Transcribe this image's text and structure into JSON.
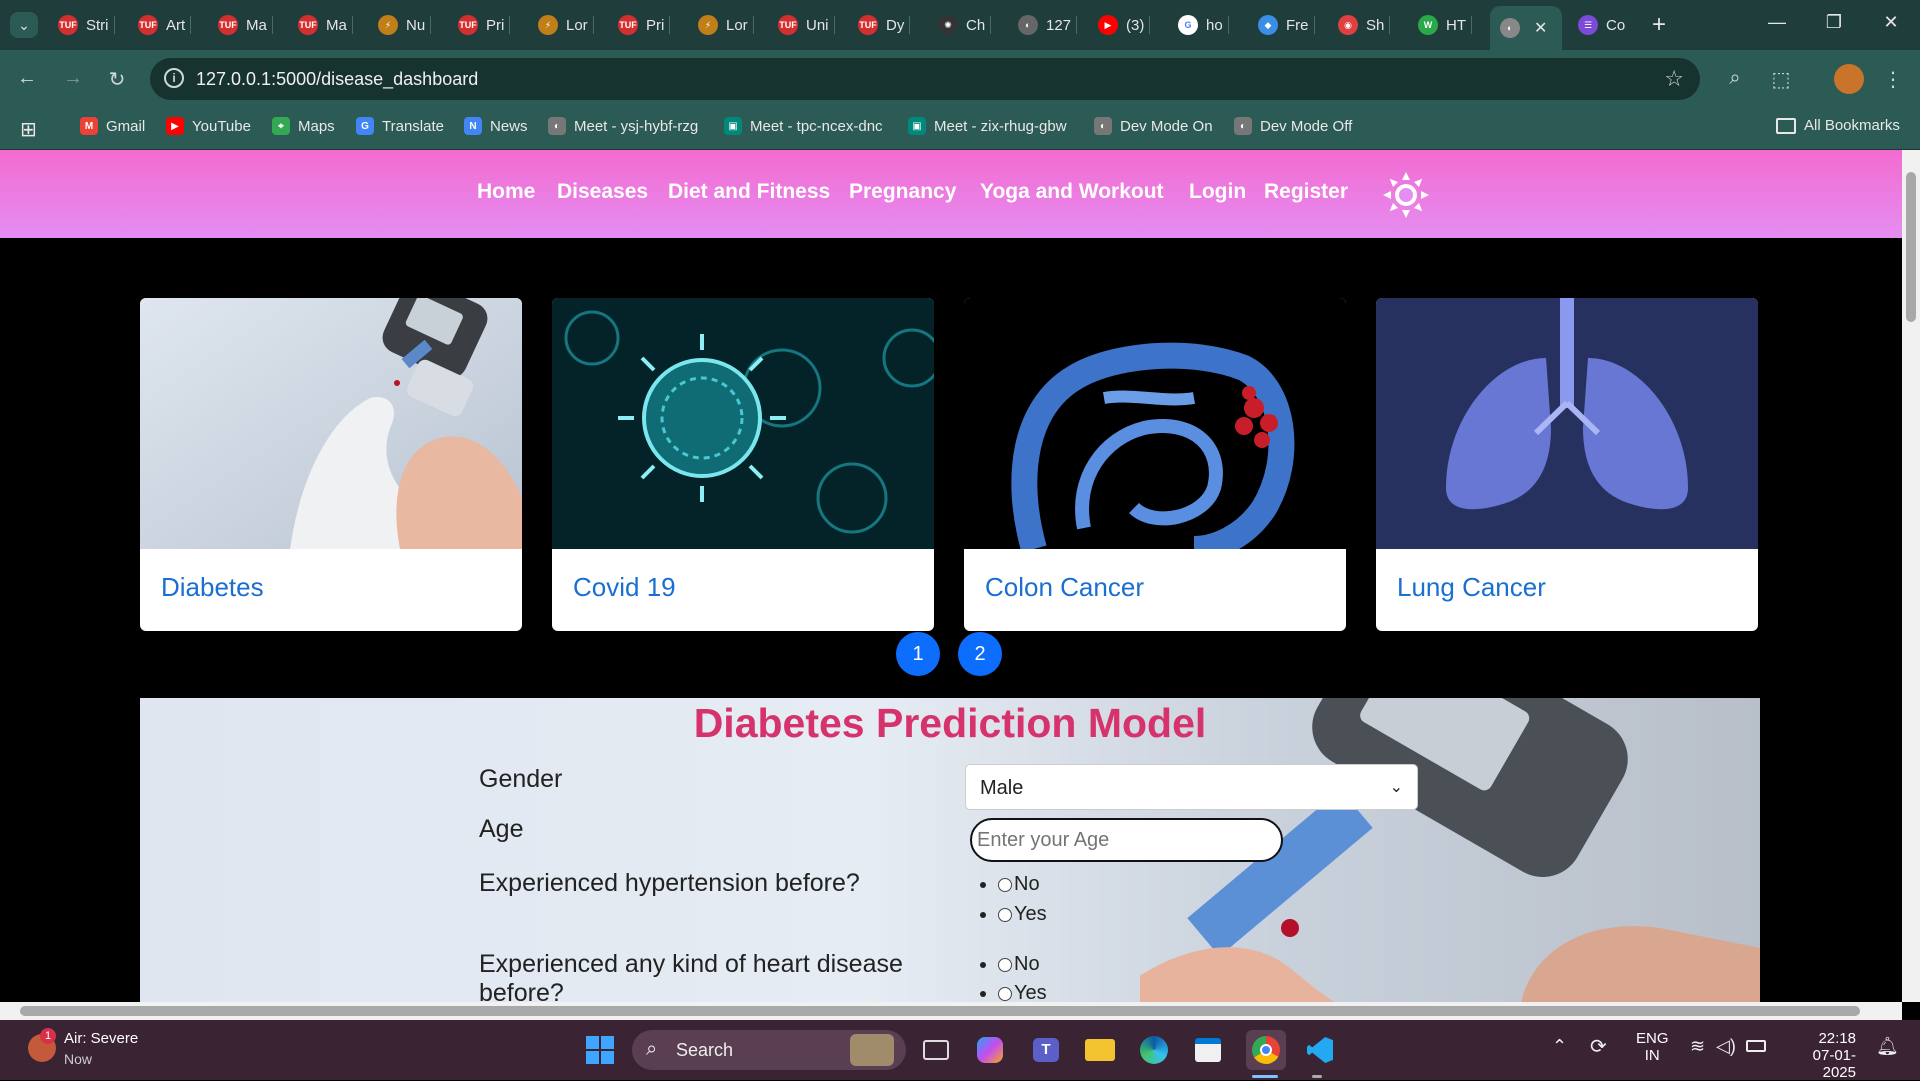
{
  "browser": {
    "tabs": [
      {
        "label": "Stri",
        "color": "#d32f2f",
        "fav": "TUF"
      },
      {
        "label": "Art",
        "color": "#d32f2f",
        "fav": "TUF"
      },
      {
        "label": "Ma",
        "color": "#d32f2f",
        "fav": "TUF"
      },
      {
        "label": "Ma",
        "color": "#d32f2f",
        "fav": "TUF"
      },
      {
        "label": "Nu",
        "color": "#c17f1a",
        "fav": "⚡"
      },
      {
        "label": "Pri",
        "color": "#d32f2f",
        "fav": "TUF"
      },
      {
        "label": "Lor",
        "color": "#c17f1a",
        "fav": "⚡"
      },
      {
        "label": "Pri",
        "color": "#d32f2f",
        "fav": "TUF"
      },
      {
        "label": "Lor",
        "color": "#c17f1a",
        "fav": "⚡"
      },
      {
        "label": "Uni",
        "color": "#d32f2f",
        "fav": "TUF"
      },
      {
        "label": "Dy",
        "color": "#d32f2f",
        "fav": "TUF"
      },
      {
        "label": "Ch",
        "color": "#333333",
        "fav": "✺"
      },
      {
        "label": "127",
        "color": "#666666",
        "fav": "◐"
      },
      {
        "label": "(3)",
        "color": "#ff0000",
        "fav": "▶"
      },
      {
        "label": "ho",
        "color": "#ffffff",
        "fav": "G"
      },
      {
        "label": "Fre",
        "color": "#3a8ee6",
        "fav": "◆"
      },
      {
        "label": "Sh",
        "color": "#e04040",
        "fav": "◉"
      },
      {
        "label": "HT",
        "color": "#2aa84a",
        "fav": "W"
      }
    ],
    "active_tab_icon": "globe-icon",
    "last_tab": {
      "label": "Co",
      "color": "#7b4ad6",
      "fav": "☰"
    },
    "new_tab": "+",
    "url": "127.0.0.1:5000/disease_dashboard",
    "bookmarks": [
      {
        "label": "Gmail",
        "color": "#ea4335",
        "icon": "M"
      },
      {
        "label": "YouTube",
        "color": "#ff0000",
        "icon": "▶"
      },
      {
        "label": "Maps",
        "color": "#34a853",
        "icon": "⌖"
      },
      {
        "label": "Translate",
        "color": "#4285f4",
        "icon": "G"
      },
      {
        "label": "News",
        "color": "#4285f4",
        "icon": "N"
      },
      {
        "label": "Meet - ysj-hybf-rzg",
        "color": "#777777",
        "icon": "◐"
      },
      {
        "label": "Meet - tpc-ncex-dnc",
        "color": "#00897b",
        "icon": "▣"
      },
      {
        "label": "Meet - zix-rhug-gbw",
        "color": "#00897b",
        "icon": "▣"
      },
      {
        "label": "Dev Mode On",
        "color": "#777777",
        "icon": "◐"
      },
      {
        "label": "Dev Mode Off",
        "color": "#777777",
        "icon": "◐"
      }
    ],
    "all_bookmarks": "All Bookmarks"
  },
  "nav": {
    "links": [
      "Home",
      "Diseases",
      "Diet and Fitness",
      "Pregnancy",
      "Yoga and Workout",
      "Login",
      "Register"
    ],
    "theme_icon": "sun-icon"
  },
  "cards": [
    {
      "title": "Diabetes",
      "icon": "glucose-meter-image"
    },
    {
      "title": "Covid 19",
      "icon": "virus-image"
    },
    {
      "title": "Colon Cancer",
      "icon": "colon-image"
    },
    {
      "title": "Lung Cancer",
      "icon": "lungs-image"
    }
  ],
  "pagination": [
    "1",
    "2"
  ],
  "model": {
    "title": "Diabetes Prediction Model",
    "gender_label": "Gender",
    "gender_value": "Male",
    "age_label": "Age",
    "age_placeholder": "Enter your Age",
    "hypertension_label": "Experienced hypertension before?",
    "heart_label_1": "Experienced any kind of heart disease",
    "heart_label_2": "before?",
    "opt_no": "No",
    "opt_yes": "Yes"
  },
  "taskbar": {
    "weather_title": "Air: Severe",
    "weather_sub": "Now",
    "weather_badge": "1",
    "search": "Search",
    "lang_1": "ENG",
    "lang_2": "IN",
    "time": "22:18",
    "date": "07-01-2025"
  }
}
